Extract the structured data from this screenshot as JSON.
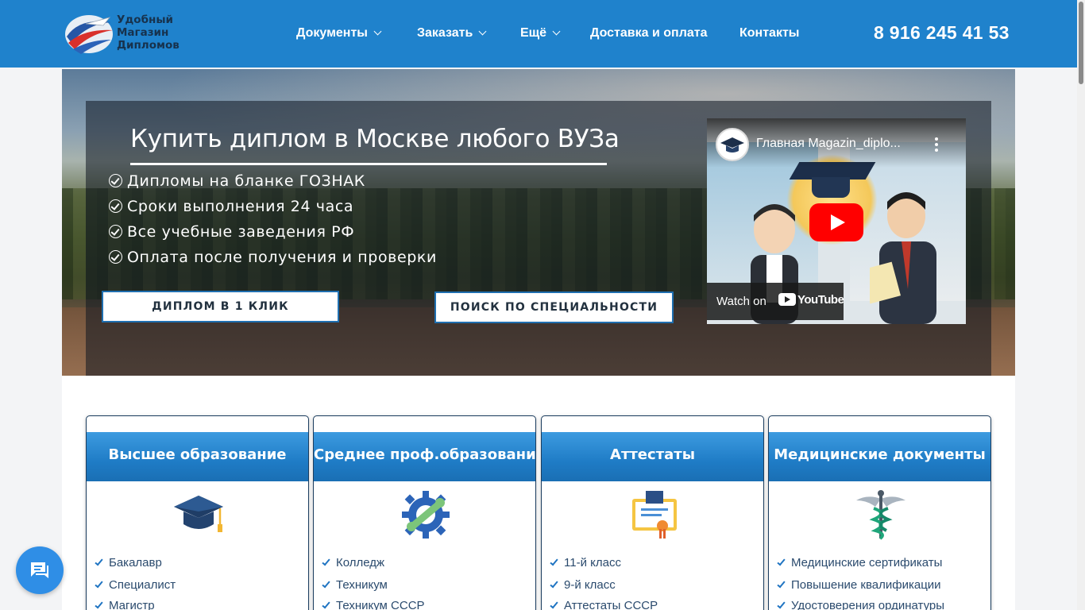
{
  "header": {
    "logo_lines": [
      "Удобный",
      "Магазин",
      "Дипломов"
    ],
    "nav": [
      {
        "label": "Документы",
        "dropdown": true
      },
      {
        "label": "Заказать",
        "dropdown": true
      },
      {
        "label": "Ещё",
        "dropdown": true
      },
      {
        "label": "Доставка и оплата",
        "dropdown": false
      },
      {
        "label": "Контакты",
        "dropdown": false
      }
    ],
    "phone": "8 916 245 41 53"
  },
  "hero": {
    "title": "Купить диплом в Москве любого ВУЗа",
    "features": [
      "Дипломы на бланке ГОЗНАК",
      "Сроки выполнения 24 часа",
      "Все учебные заведения РФ",
      "Оплата после получения и проверки"
    ],
    "buttons": {
      "one_click": "ДИПЛОМ В 1 КЛИК",
      "search": "ПОИСК ПО СПЕЦИАЛЬНОСТИ"
    },
    "video": {
      "title": "Главная Magazin_diplo...",
      "watch_on": "Watch on",
      "platform": "YouTube"
    }
  },
  "cards": [
    {
      "title": "Высшее образование",
      "icon": "graduation-cap-icon",
      "items": [
        "Бакалавр",
        "Специалист",
        "Магистр"
      ]
    },
    {
      "title": "Среднее проф.образование",
      "icon": "gear-wrench-icon",
      "items": [
        "Колледж",
        "Техникум",
        "Техникум СССР"
      ]
    },
    {
      "title": "Аттестаты",
      "icon": "certificate-icon",
      "items": [
        "11-й класс",
        "9-й класс",
        "Аттестаты СССР"
      ]
    },
    {
      "title": "Медицинские документы",
      "icon": "caduceus-icon",
      "items": [
        "Медицинские сертификаты",
        "Повышение квалификации",
        "Удостоверения ординатуры"
      ]
    }
  ],
  "colors": {
    "header_bg": "#1f82cc",
    "card_head": "#1f7cc6",
    "chat_button": "#2f8ee6",
    "play_button": "#ff0000"
  }
}
